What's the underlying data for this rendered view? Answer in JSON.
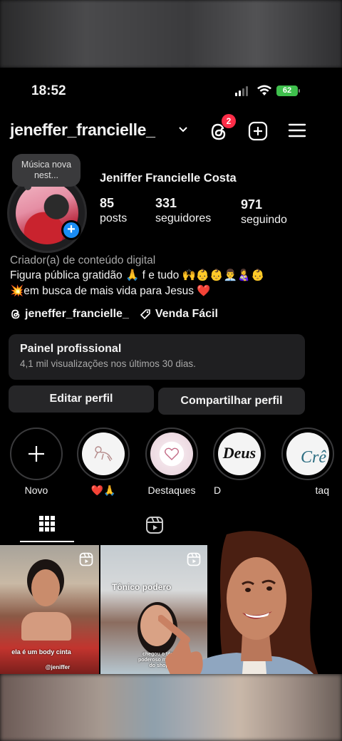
{
  "status": {
    "time": "18:52",
    "battery": "62"
  },
  "header": {
    "username": "jeneffer_francielle_",
    "notifications": "2"
  },
  "note": {
    "text": "Música nova nest..."
  },
  "profile": {
    "full_name": "Jeniffer Francielle Costa",
    "stats": [
      {
        "value": "85",
        "label": "posts"
      },
      {
        "value": "331",
        "label": "seguidores"
      },
      {
        "value": "971",
        "label": "seguindo"
      }
    ],
    "category": "Criador(a) de conteúdo digital",
    "bio_line1": "Figura pública gratidão 🙏 f e tudo 🙌👶👶👨‍💼👩‍🍼👶",
    "bio_line2": "💥em busca de mais vida para Jesus ❤️",
    "threads_link": "jeneffer_francielle_",
    "shop_link": "Venda Fácil"
  },
  "panel": {
    "title": "Painel profissional",
    "subtitle": "4,1 mil visualizações nos últimos 30 dias."
  },
  "buttons": {
    "edit": "Editar perfil",
    "share": "Compartilhar perfil"
  },
  "highlights": [
    {
      "label": "Novo"
    },
    {
      "label": "❤️🙏"
    },
    {
      "label": "Destaques"
    },
    {
      "label": "D"
    },
    {
      "label": "taq"
    }
  ],
  "highlight_text": {
    "deus": "Deus",
    "cre": "Crê"
  },
  "posts": [
    {
      "caption": "ela é um body cinta",
      "tag": "@jeniffer"
    },
    {
      "title": "Tônico podero",
      "caption": "chegou o tônico poderoso mais aqui do shopee"
    }
  ],
  "colors": {
    "accent": "#1a8cf4",
    "badge": "#ff2d48",
    "battery": "#3fc04d"
  }
}
